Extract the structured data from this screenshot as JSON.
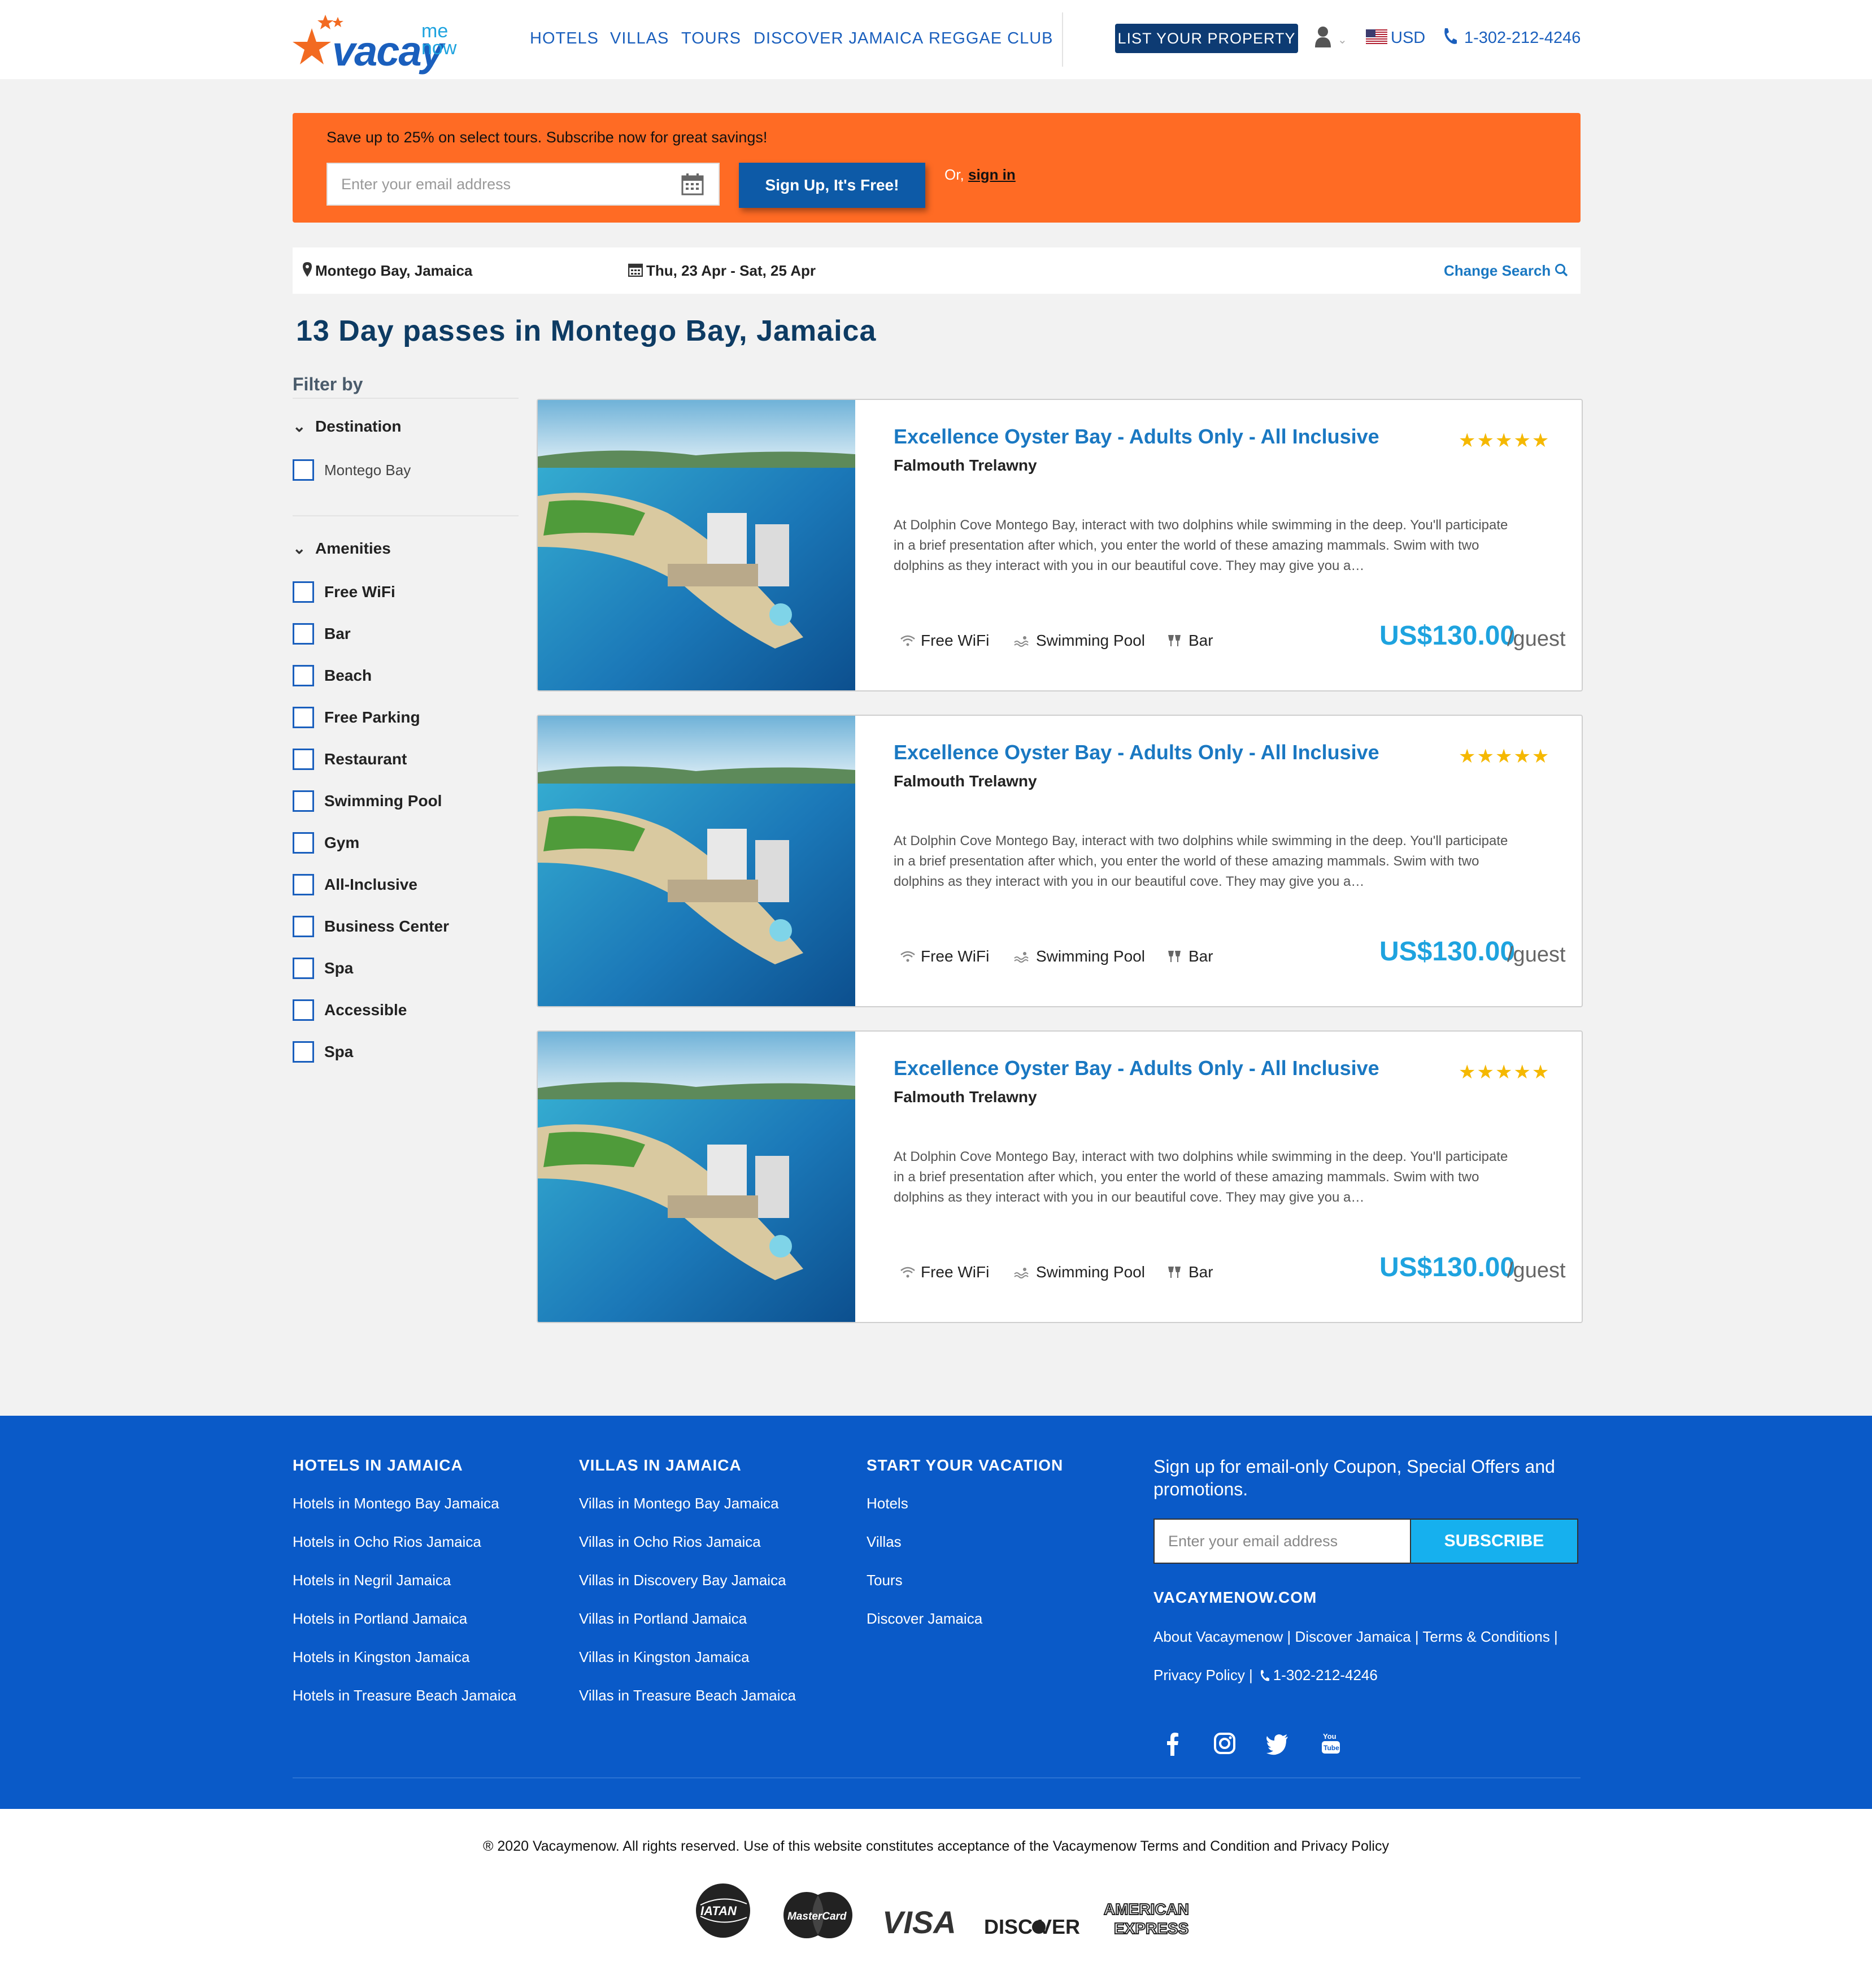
{
  "header": {
    "logo": {
      "word": "vacay",
      "me": "me",
      "now": "now"
    },
    "nav": [
      "HOTELS",
      "VILLAS",
      "TOURS",
      "DISCOVER JAMAICA",
      "REGGAE CLUB"
    ],
    "list_property": "LIST YOUR PROPERTY",
    "currency": "USD",
    "phone": "1-302-212-4246"
  },
  "promo": {
    "text": "Save up to 25% on select tours. Subscribe now for great savings!",
    "email_placeholder": "Enter your email address",
    "signup_label": "Sign Up, It's Free!",
    "or_text": "Or,",
    "signin_label": "sign in"
  },
  "search": {
    "location": "Montego Bay, Jamaica",
    "dates": "Thu, 23 Apr - Sat, 25 Apr",
    "change_label": "Change Search"
  },
  "page_title": "13 Day passes in Montego Bay, Jamaica",
  "sidebar": {
    "filter_by": "Filter by",
    "destination_title": "Destination",
    "destinations": [
      "Montego Bay"
    ],
    "amenities_title": "Amenities",
    "amenities": [
      "Free WiFi",
      "Bar",
      "Beach",
      "Free Parking",
      "Restaurant",
      "Swimming Pool",
      "Gym",
      "All-Inclusive",
      "Business Center",
      "Spa",
      "Accessible",
      "Spa"
    ]
  },
  "results": [
    {
      "title": "Excellence Oyster Bay - Adults Only - All Inclusive",
      "location": "Falmouth Trelawny",
      "rating": 5,
      "stars": "★★★★★",
      "description": "At Dolphin Cove Montego Bay, interact with two dolphins while swimming in the deep. You'll participate in a brief presentation after which, you enter the world of these amazing mammals. Swim with two dolphins as they interact with you in our beautiful cove. They may give you a…",
      "amenities": [
        "Free WiFi",
        "Swimming Pool",
        "Bar"
      ],
      "price": "US$130.00",
      "per": "/guest"
    },
    {
      "title": "Excellence Oyster Bay - Adults Only - All Inclusive",
      "location": "Falmouth Trelawny",
      "rating": 5,
      "stars": "★★★★★",
      "description": "At Dolphin Cove Montego Bay, interact with two dolphins while swimming in the deep. You'll participate in a brief presentation after which, you enter the world of these amazing mammals. Swim with two dolphins as they interact with you in our beautiful cove. They may give you a…",
      "amenities": [
        "Free WiFi",
        "Swimming Pool",
        "Bar"
      ],
      "price": "US$130.00",
      "per": "/guest"
    },
    {
      "title": "Excellence Oyster Bay - Adults Only - All Inclusive",
      "location": "Falmouth Trelawny",
      "rating": 5,
      "stars": "★★★★★",
      "description": "At Dolphin Cove Montego Bay, interact with two dolphins while swimming in the deep. You'll participate in a brief presentation after which, you enter the world of these amazing mammals. Swim with two dolphins as they interact with you in our beautiful cove. They may give you a…",
      "amenities": [
        "Free WiFi",
        "Swimming Pool",
        "Bar"
      ],
      "price": "US$130.00",
      "per": "/guest"
    }
  ],
  "footer": {
    "columns": [
      {
        "title": "HOTELS IN JAMAICA",
        "links": [
          "Hotels in Montego Bay Jamaica",
          "Hotels in Ocho Rios Jamaica",
          "Hotels in Negril Jamaica",
          "Hotels in Portland Jamaica",
          "Hotels in Kingston Jamaica",
          "Hotels in Treasure Beach Jamaica"
        ]
      },
      {
        "title": "VILLAS IN JAMAICA",
        "links": [
          "Villas in Montego Bay Jamaica",
          "Villas in Ocho Rios Jamaica",
          "Villas in Discovery Bay Jamaica",
          "Villas in Portland Jamaica",
          "Villas in Kingston Jamaica",
          "Villas in Treasure Beach Jamaica"
        ]
      },
      {
        "title": "START YOUR VACATION",
        "links": [
          "Hotels",
          "Villas",
          "Tours",
          "Discover Jamaica"
        ]
      }
    ],
    "signup_text": "Sign up for email-only Coupon, Special Offers and promotions.",
    "email_placeholder": "Enter your email address",
    "subscribe_label": "SUBSCRIBE",
    "domain": "VACAYMENOW.COM",
    "links_line1": "About Vacaymenow | Discover Jamaica | Terms & Conditions |",
    "links_line2_privacy": "Privacy Policy |",
    "links_line2_phone": "1-302-212-4246",
    "social": [
      "facebook-icon",
      "instagram-icon",
      "twitter-icon",
      "youtube-icon"
    ]
  },
  "bottom": {
    "copyright": "® 2020 Vacaymenow. All rights reserved. Use of this website constitutes acceptance of the Vacaymenow Terms and Condition and Privacy Policy",
    "payments": {
      "iata": "IATAN",
      "mastercard": "MasterCard",
      "visa": "VISA",
      "discover": "DISC VER",
      "amex_1": "AMERICAN",
      "amex_2": "EXPRESS"
    }
  },
  "colors": {
    "brand_blue": "#1a5fbd",
    "promo_orange": "#ff6b24",
    "footer_blue": "#0a5ac8",
    "price_blue": "#1ea3df",
    "star_gold": "#f5b800"
  }
}
